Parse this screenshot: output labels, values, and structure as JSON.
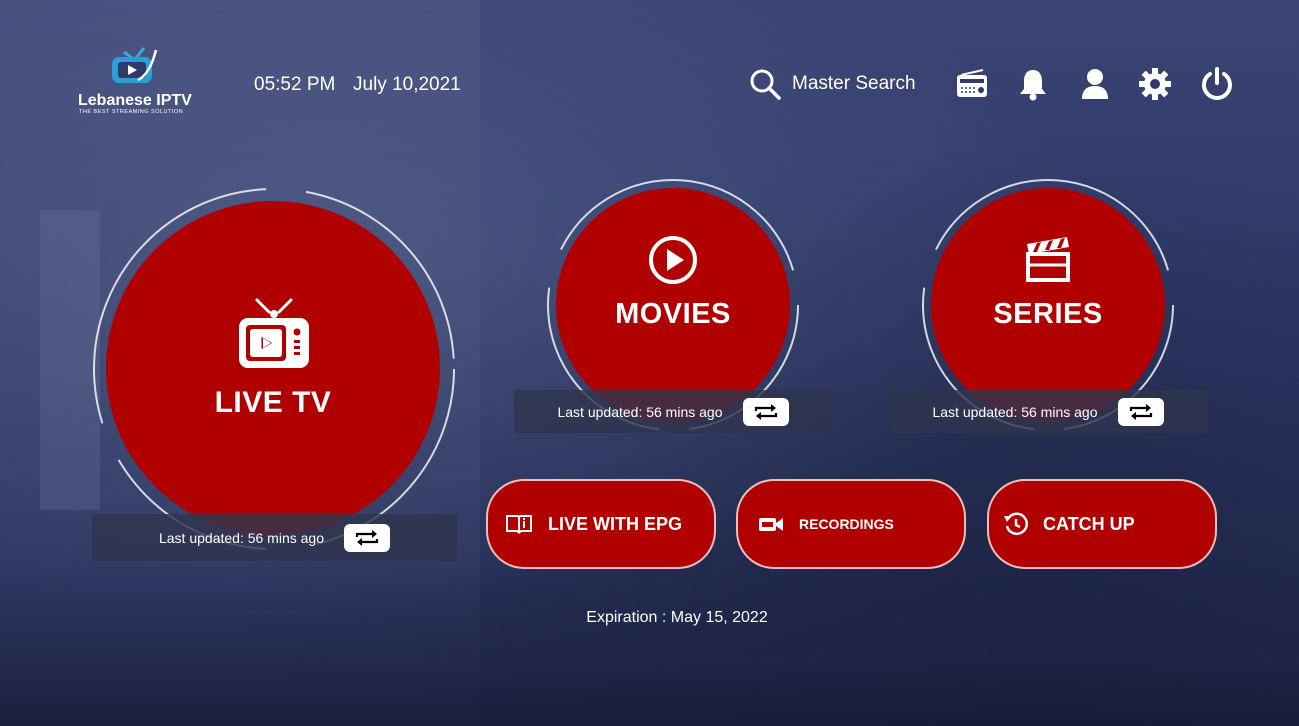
{
  "app": {
    "brand": "Lebanese IPTV",
    "tagline": "THE BEST STREAMING SOLUTION"
  },
  "header": {
    "time": "05:52 PM",
    "date": "July 10,2021",
    "search_label": "Master Search",
    "icons": [
      "radio-icon",
      "bell-icon",
      "user-icon",
      "gear-icon",
      "power-icon"
    ]
  },
  "tiles": {
    "live_tv": {
      "label": "LIVE TV",
      "updated": "Last updated: 56 mins ago",
      "icon": "tv-icon"
    },
    "movies": {
      "label": "MOVIES",
      "updated": "Last updated: 56 mins ago",
      "icon": "play-circle-icon"
    },
    "series": {
      "label": "SERIES",
      "updated": "Last updated: 56 mins ago",
      "icon": "clapperboard-icon"
    }
  },
  "buttons": {
    "live_epg": {
      "label": "LIVE WITH EPG",
      "icon": "book-icon"
    },
    "recordings": {
      "label": "RECORDINGS",
      "icon": "rec-camera-icon"
    },
    "catch_up": {
      "label": "CATCH UP",
      "icon": "history-icon"
    }
  },
  "footer": {
    "expiration": "Expiration : May 15, 2022"
  },
  "colors": {
    "accent": "#b00000",
    "background": "#2f3a68",
    "text": "#ffffff"
  }
}
